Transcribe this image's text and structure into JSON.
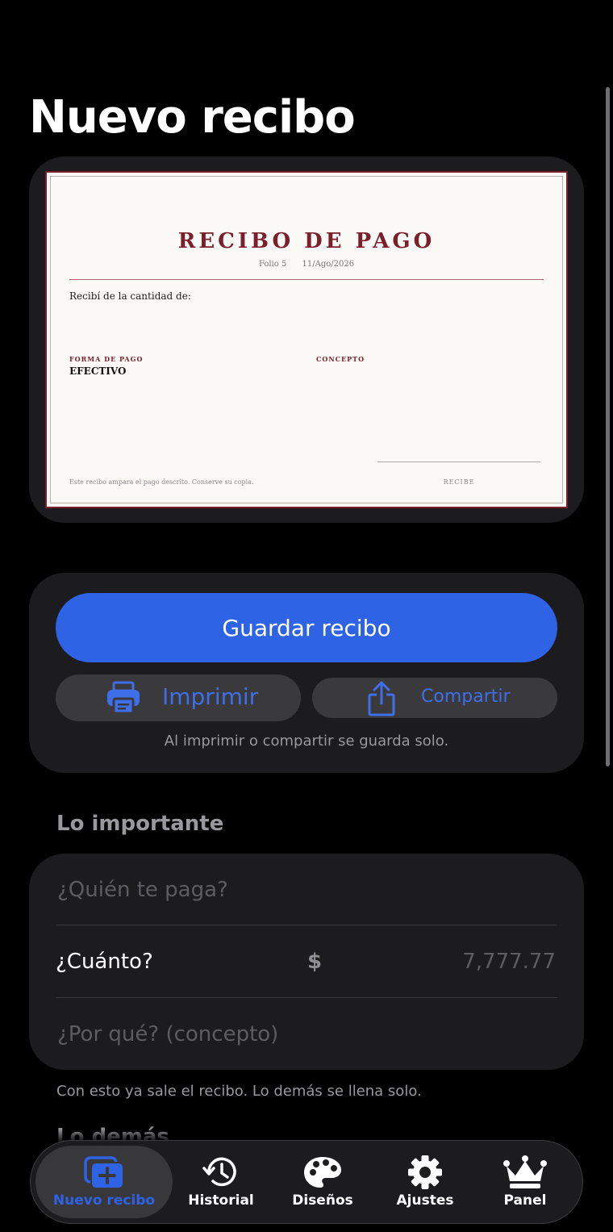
{
  "page": {
    "title": "Nuevo recibo"
  },
  "receipt": {
    "title": "RECIBO DE PAGO",
    "folio": "Folio 5",
    "date": "11/Ago/2026",
    "received_text": "Recibí de  la cantidad de:",
    "payment_method_label": "FORMA DE PAGO",
    "payment_method_value": "EFECTIVO",
    "concept_label": "CONCEPTO",
    "footer_note": "Este recibo ampara el pago descrito. Conserve su copia.",
    "receives_label": "RECIBE",
    "colors": {
      "accent": "#7a1f2b",
      "paper": "#faf9f6"
    }
  },
  "actions": {
    "save_label": "Guardar recibo",
    "print_label": "Imprimir",
    "share_label": "Compartir",
    "note": "Al imprimir o compartir se guarda solo.",
    "icons": {
      "print": "printer-icon",
      "share": "share-icon"
    },
    "colors": {
      "primary": "#2f63e6"
    }
  },
  "important": {
    "section_title": "Lo importante",
    "payer_placeholder": "¿Quién te paga?",
    "amount_label": "¿Cuánto?",
    "currency_symbol": "$",
    "amount_placeholder": "7,777.77",
    "concept_placeholder": "¿Por qué? (concepto)",
    "note": "Con esto ya sale el recibo. Lo demás se llena solo."
  },
  "others": {
    "section_title": "Lo demás"
  },
  "tabbar": {
    "tabs": [
      {
        "label": "Nuevo recibo",
        "icon": "new-receipt-icon",
        "active": true
      },
      {
        "label": "Historial",
        "icon": "history-icon",
        "active": false
      },
      {
        "label": "Diseños",
        "icon": "palette-icon",
        "active": false
      },
      {
        "label": "Ajustes",
        "icon": "gear-icon",
        "active": false
      },
      {
        "label": "Panel",
        "icon": "crown-icon",
        "active": false
      }
    ]
  }
}
